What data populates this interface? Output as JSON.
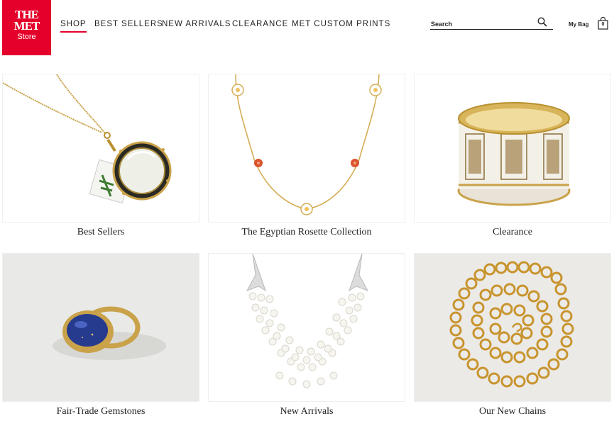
{
  "logo": {
    "line1": "THE",
    "line2": "MET",
    "line3": "Store"
  },
  "nav": {
    "items": [
      {
        "label": "SHOP",
        "active": true
      },
      {
        "label": "BEST SELLERS",
        "active": false
      },
      {
        "label": "NEW ARRIVALS",
        "active": false
      },
      {
        "label": "CLEARANCE",
        "active": false
      },
      {
        "label": "MET CUSTOM PRINTS",
        "active": false
      }
    ]
  },
  "search": {
    "placeholder": "Search",
    "value": "",
    "icon": "search-icon"
  },
  "bag": {
    "label": "My Bag",
    "count": "0",
    "icon": "shopping-bag-icon"
  },
  "tiles": [
    {
      "caption": "Best Sellers",
      "image": "magnifier-pendant-necklace"
    },
    {
      "caption": "The Egyptian Rosette Collection",
      "image": "rosette-station-necklace"
    },
    {
      "caption": "Clearance",
      "image": "enamel-bangle"
    },
    {
      "caption": "Fair-Trade Gemstones",
      "image": "lapis-gold-ring"
    },
    {
      "caption": "New Arrivals",
      "image": "pearl-multistrand-necklace"
    },
    {
      "caption": "Our New Chains",
      "image": "gold-link-chain"
    }
  ],
  "colors": {
    "brand_red": "#e4002b",
    "text": "#222222",
    "gold": "#c9a24a"
  }
}
